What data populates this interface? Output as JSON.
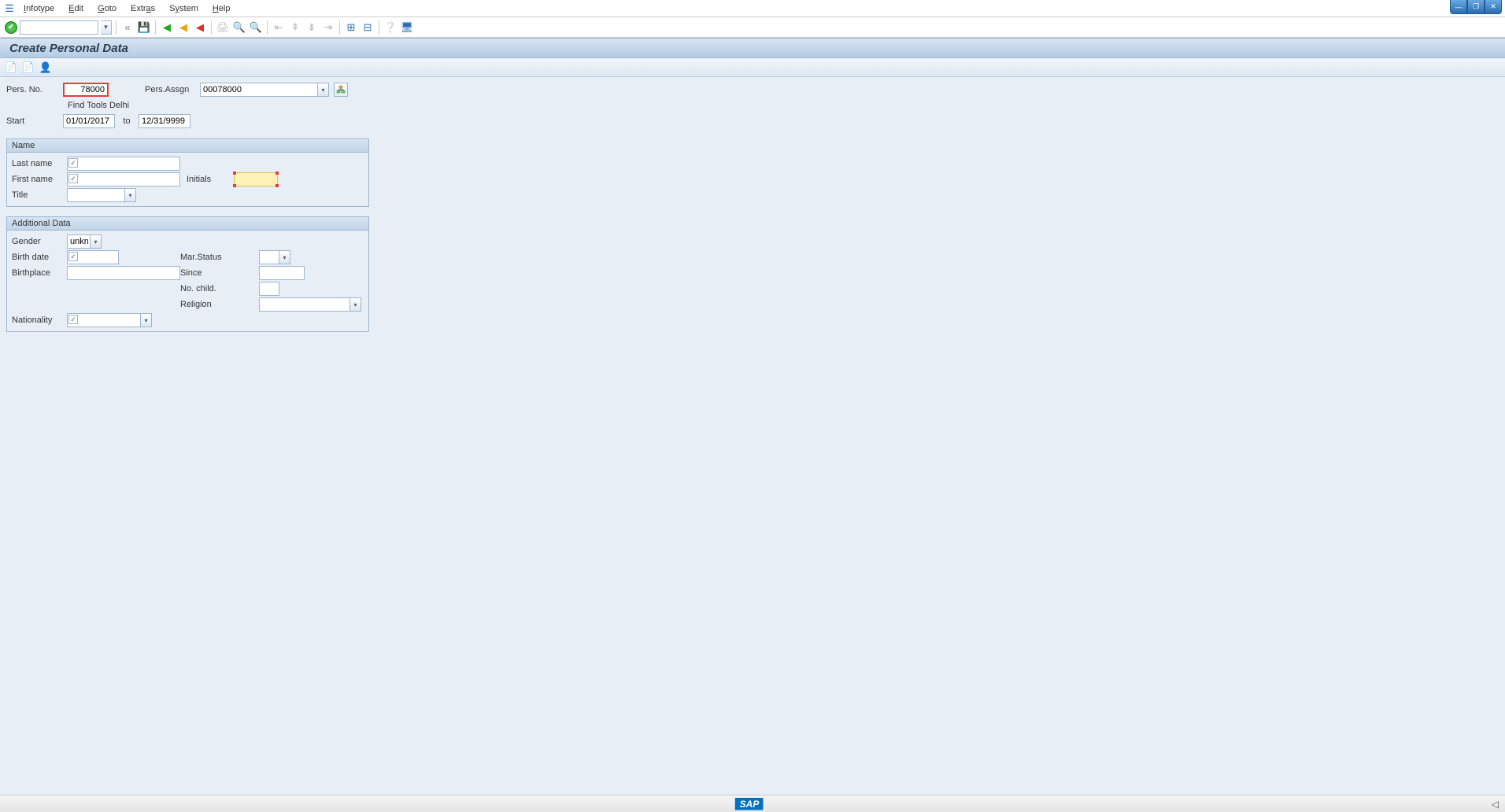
{
  "menu": {
    "items": [
      "Infotype",
      "Edit",
      "Goto",
      "Extras",
      "System",
      "Help"
    ]
  },
  "title": "Create Personal Data",
  "header": {
    "pers_no_label": "Pers. No.",
    "pers_no_value": "78000",
    "pers_assgn_label": "Pers.Assgn",
    "pers_assgn_value": "00078000",
    "find_text": "Find Tools Delhi",
    "start_label": "Start",
    "start_value": "01/01/2017",
    "to_label": "to",
    "end_value": "12/31/9999"
  },
  "name_group": {
    "title": "Name",
    "last_name_label": "Last name",
    "last_name_value": "",
    "first_name_label": "First name",
    "first_name_value": "",
    "initials_label": "Initials",
    "initials_value": "",
    "title_label": "Title",
    "title_value": ""
  },
  "additional_group": {
    "title": "Additional Data",
    "gender_label": "Gender",
    "gender_value": "unkn..",
    "birth_date_label": "Birth date",
    "birth_date_value": "",
    "birthplace_label": "Birthplace",
    "birthplace_value": "",
    "mar_status_label": "Mar.Status",
    "mar_status_value": "",
    "since_label": "Since",
    "since_value": "",
    "no_child_label": "No. child.",
    "no_child_value": "",
    "religion_label": "Religion",
    "religion_value": "",
    "nationality_label": "Nationality",
    "nationality_value": ""
  },
  "statusbar": {
    "logo": "SAP",
    "indicator": "◁"
  }
}
